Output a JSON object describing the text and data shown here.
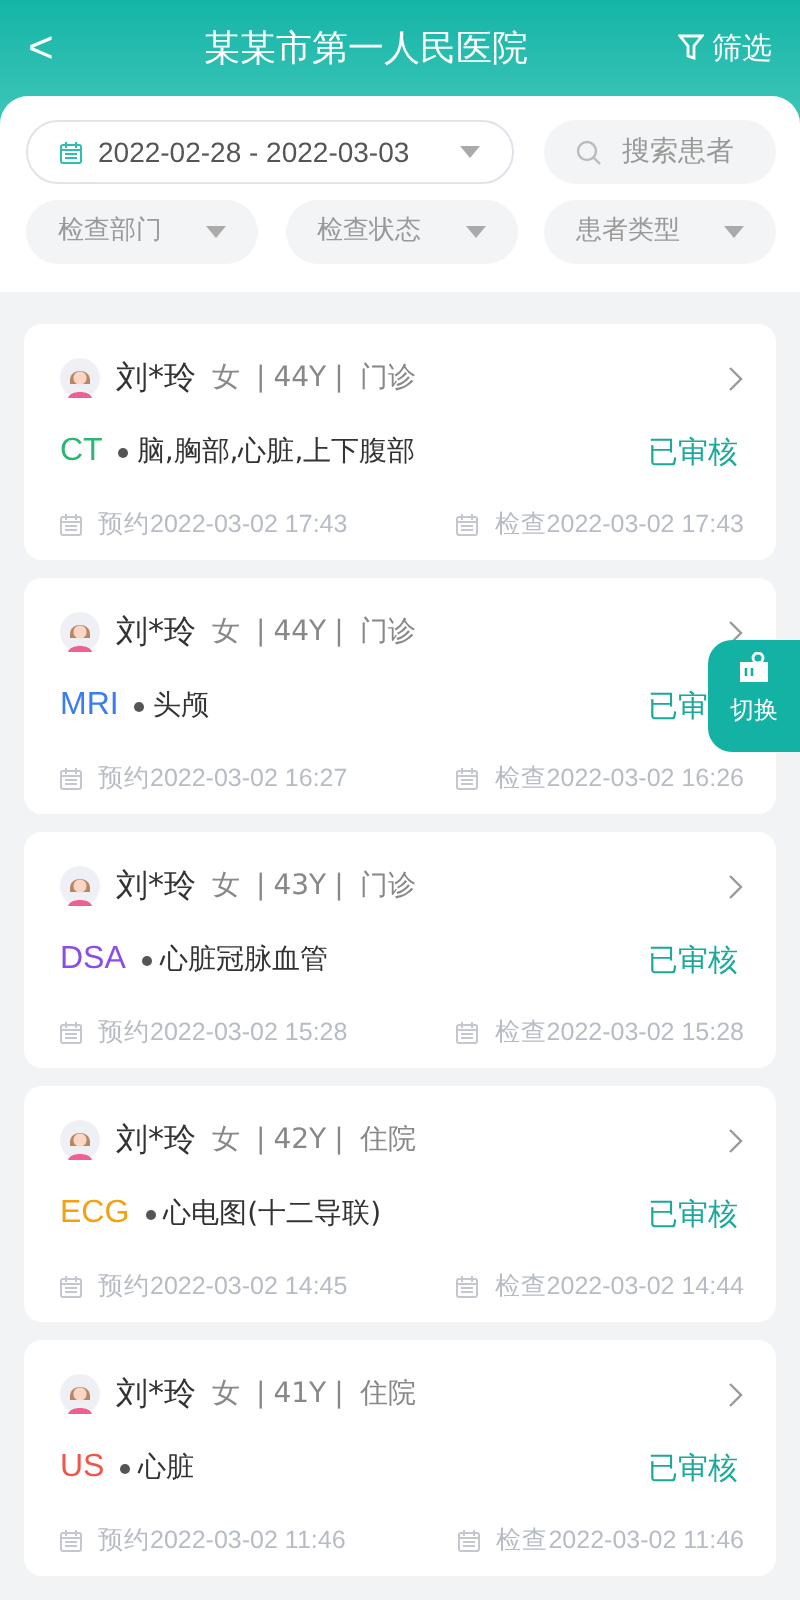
{
  "header": {
    "back": "<",
    "title": "某某市第一人民医院",
    "filter": "筛选"
  },
  "filters": {
    "date_range": "2022-02-28 - 2022-03-03",
    "search": {
      "placeholder": "搜索患者"
    },
    "dropdowns": [
      "检查部门",
      "检查状态",
      "患者类型"
    ]
  },
  "records": [
    {
      "name": "刘*玲",
      "gender": "女",
      "separators": [
        "|",
        "|"
      ],
      "age": "44Y",
      "visit_type": "门诊",
      "modality": "CT",
      "color": "#2bb673",
      "exam": "脑,胸部,心脏,上下腹部",
      "status": "已审核",
      "appointment": "预约2022-03-02 17:43",
      "exam_time": "检查2022-03-02 17:43"
    },
    {
      "name": "刘*玲",
      "gender": "女",
      "separators": [
        "|",
        "|"
      ],
      "age": "44Y",
      "visit_type": "门诊",
      "modality": "MRI",
      "color": "#3b7cf0",
      "exam": "头颅",
      "status": "已审",
      "appointment": "预约2022-03-02 16:27",
      "exam_time": "检查2022-03-02 16:26"
    },
    {
      "name": "刘*玲",
      "gender": "女",
      "separators": [
        "|",
        "|"
      ],
      "age": "43Y",
      "visit_type": "门诊",
      "modality": "DSA",
      "color": "#8a4ee6",
      "exam": "心脏冠脉血管",
      "status": "已审核",
      "appointment": "预约2022-03-02 15:28",
      "exam_time": "检查2022-03-02 15:28"
    },
    {
      "name": "刘*玲",
      "gender": "女",
      "separators": [
        "|",
        "|"
      ],
      "age": "42Y",
      "visit_type": "住院",
      "modality": "ECG",
      "color": "#f5a011",
      "exam": "心电图(十二导联)",
      "status": "已审核",
      "appointment": "预约2022-03-02 14:45",
      "exam_time": "检查2022-03-02 14:44"
    },
    {
      "name": "刘*玲",
      "gender": "女",
      "separators": [
        "|",
        "|"
      ],
      "age": "41Y",
      "visit_type": "住院",
      "modality": "US",
      "color": "#f0564a",
      "exam": "心脏",
      "status": "已审核",
      "appointment": "预约2022-03-02 11:46",
      "exam_time": "检查2022-03-02 11:46"
    }
  ],
  "switch_button": "切换"
}
